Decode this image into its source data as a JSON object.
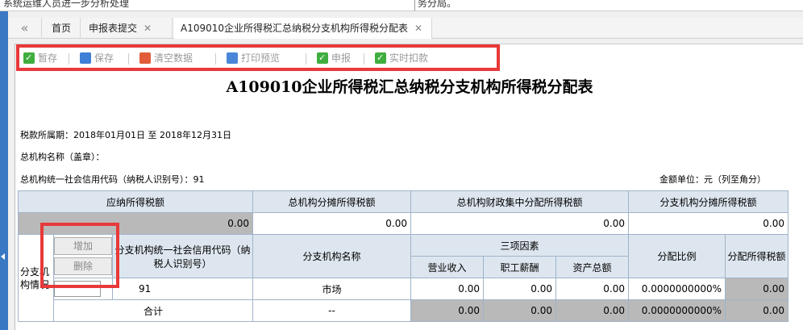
{
  "top_strip": {
    "left_text": "系统运维人员进一步分析处理",
    "right_text": "务分局。"
  },
  "tabs": [
    {
      "label": "首页"
    },
    {
      "label": "申报表提交",
      "close": "✕"
    },
    {
      "label": "A109010企业所得税汇总纳税分支机构所得税分配表",
      "close": "✕"
    }
  ],
  "back_glyph": "«",
  "toolbar": {
    "save_temp": "暂存",
    "save": "保存",
    "clear": "清空数据",
    "print": "打印预览",
    "declare": "申报",
    "deduct": "实时扣款"
  },
  "form": {
    "title": "A109010企业所得税汇总纳税分支机构所得税分配表",
    "period": "税款所属期：2018年01月01日  至  2018年12月31日",
    "org_name": "总机构名称（盖章）：",
    "credit_code": "总机构统一社会信用代码（纳税人识别号）：91",
    "unit": "金额单位：元（列至角分）"
  },
  "summary_headers": [
    "应纳所得税额",
    "总机构分摊所得税额",
    "总机构财政集中分配所得税额",
    "分支机构分摊所得税额"
  ],
  "summary_values": [
    "0.00",
    "0.00",
    "0.00",
    "0.00"
  ],
  "detail": {
    "add_button": "增加",
    "delete_button": "删除",
    "side_label": "分支机构情况",
    "col_code": "分支机构统一社会信用代码（纳税人识别号）",
    "col_name": "分支机构名称",
    "col_factors": "三项因素",
    "col_revenue": "营业收入",
    "col_salary": "职工薪酬",
    "col_assets": "资产总额",
    "col_ratio": "分配比例",
    "col_tax": "分配所得税额",
    "row": {
      "code": "91",
      "name": "市场",
      "revenue": "0.00",
      "salary": "0.00",
      "assets": "0.00",
      "ratio": "0.0000000000%",
      "tax": "0.00"
    },
    "total": {
      "label": "合计",
      "name": "--",
      "revenue": "0.00",
      "salary": "0.00",
      "assets": "0.00",
      "ratio": "0.0000000000%",
      "tax": "0.00"
    }
  }
}
